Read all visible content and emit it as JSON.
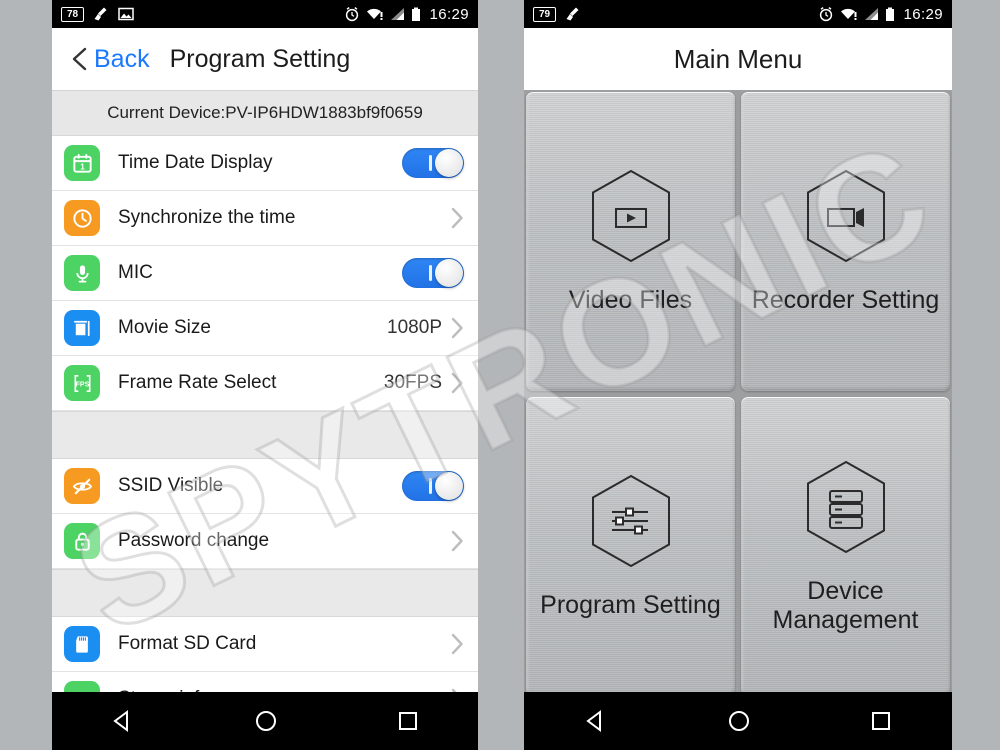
{
  "background_color": "#b3b6b8",
  "watermark": {
    "text": "SPYTRONIC"
  },
  "left_phone": {
    "statusbar": {
      "notification_badge": "78",
      "icons": [
        "broom-icon",
        "image-icon"
      ],
      "right_icons": [
        "alarm-icon",
        "wifi-alert-icon",
        "signal-icon",
        "battery-icon"
      ],
      "time": "16:29"
    },
    "navbar": {
      "back_label": "Back",
      "back_icon": "chevron-left-icon",
      "title": "Program Setting"
    },
    "device_bar": {
      "text": "Current Device:PV-IP6HDW1883bf9f0659"
    },
    "sections": [
      {
        "rows": [
          {
            "icon": "calendar-icon",
            "icon_color": "#4cd363",
            "label": "Time Date Display",
            "control": "toggle",
            "value": "on"
          },
          {
            "icon": "clock-icon",
            "icon_color": "#f79a22",
            "label": "Synchronize the time",
            "control": "chevron",
            "value": ""
          },
          {
            "icon": "microphone-icon",
            "icon_color": "#4cd363",
            "label": "MIC",
            "control": "toggle",
            "value": "on"
          },
          {
            "icon": "film-icon",
            "icon_color": "#1b8ef2",
            "label": "Movie Size",
            "control": "chevron",
            "value": "1080P"
          },
          {
            "icon": "fps-icon",
            "icon_color": "#4cd363",
            "label": "Frame Rate Select",
            "control": "chevron",
            "value": "30FPS"
          }
        ]
      },
      {
        "rows": [
          {
            "icon": "eye-slash-icon",
            "icon_color": "#f79a22",
            "label": "SSID Visible",
            "control": "toggle",
            "value": "on"
          },
          {
            "icon": "lock-icon",
            "icon_color": "#4cd363",
            "label": "Password change",
            "control": "chevron",
            "value": ""
          }
        ]
      },
      {
        "rows": [
          {
            "icon": "sd-card-icon",
            "icon_color": "#1b8ef2",
            "label": "Format SD Card",
            "control": "chevron",
            "value": ""
          },
          {
            "icon": "info-icon",
            "icon_color": "#4cd363",
            "label": "Storge info",
            "control": "chevron",
            "value": ""
          }
        ]
      }
    ],
    "android_nav": [
      "back-triangle-icon",
      "home-circle-icon",
      "recents-square-icon"
    ]
  },
  "right_phone": {
    "statusbar": {
      "notification_badge": "79",
      "icons": [
        "broom-icon"
      ],
      "right_icons": [
        "alarm-icon",
        "wifi-alert-icon",
        "signal-icon",
        "battery-icon"
      ],
      "time": "16:29"
    },
    "title": "Main Menu",
    "tiles": [
      {
        "icon": "video-play-hex-icon",
        "label": "Video Files"
      },
      {
        "icon": "camcorder-hex-icon",
        "label": "Recorder Setting"
      },
      {
        "icon": "sliders-hex-icon",
        "label": "Program Setting"
      },
      {
        "icon": "server-stack-hex-icon",
        "label": "Device Management"
      }
    ],
    "android_nav": [
      "back-triangle-icon",
      "home-circle-icon",
      "recents-square-icon"
    ]
  }
}
